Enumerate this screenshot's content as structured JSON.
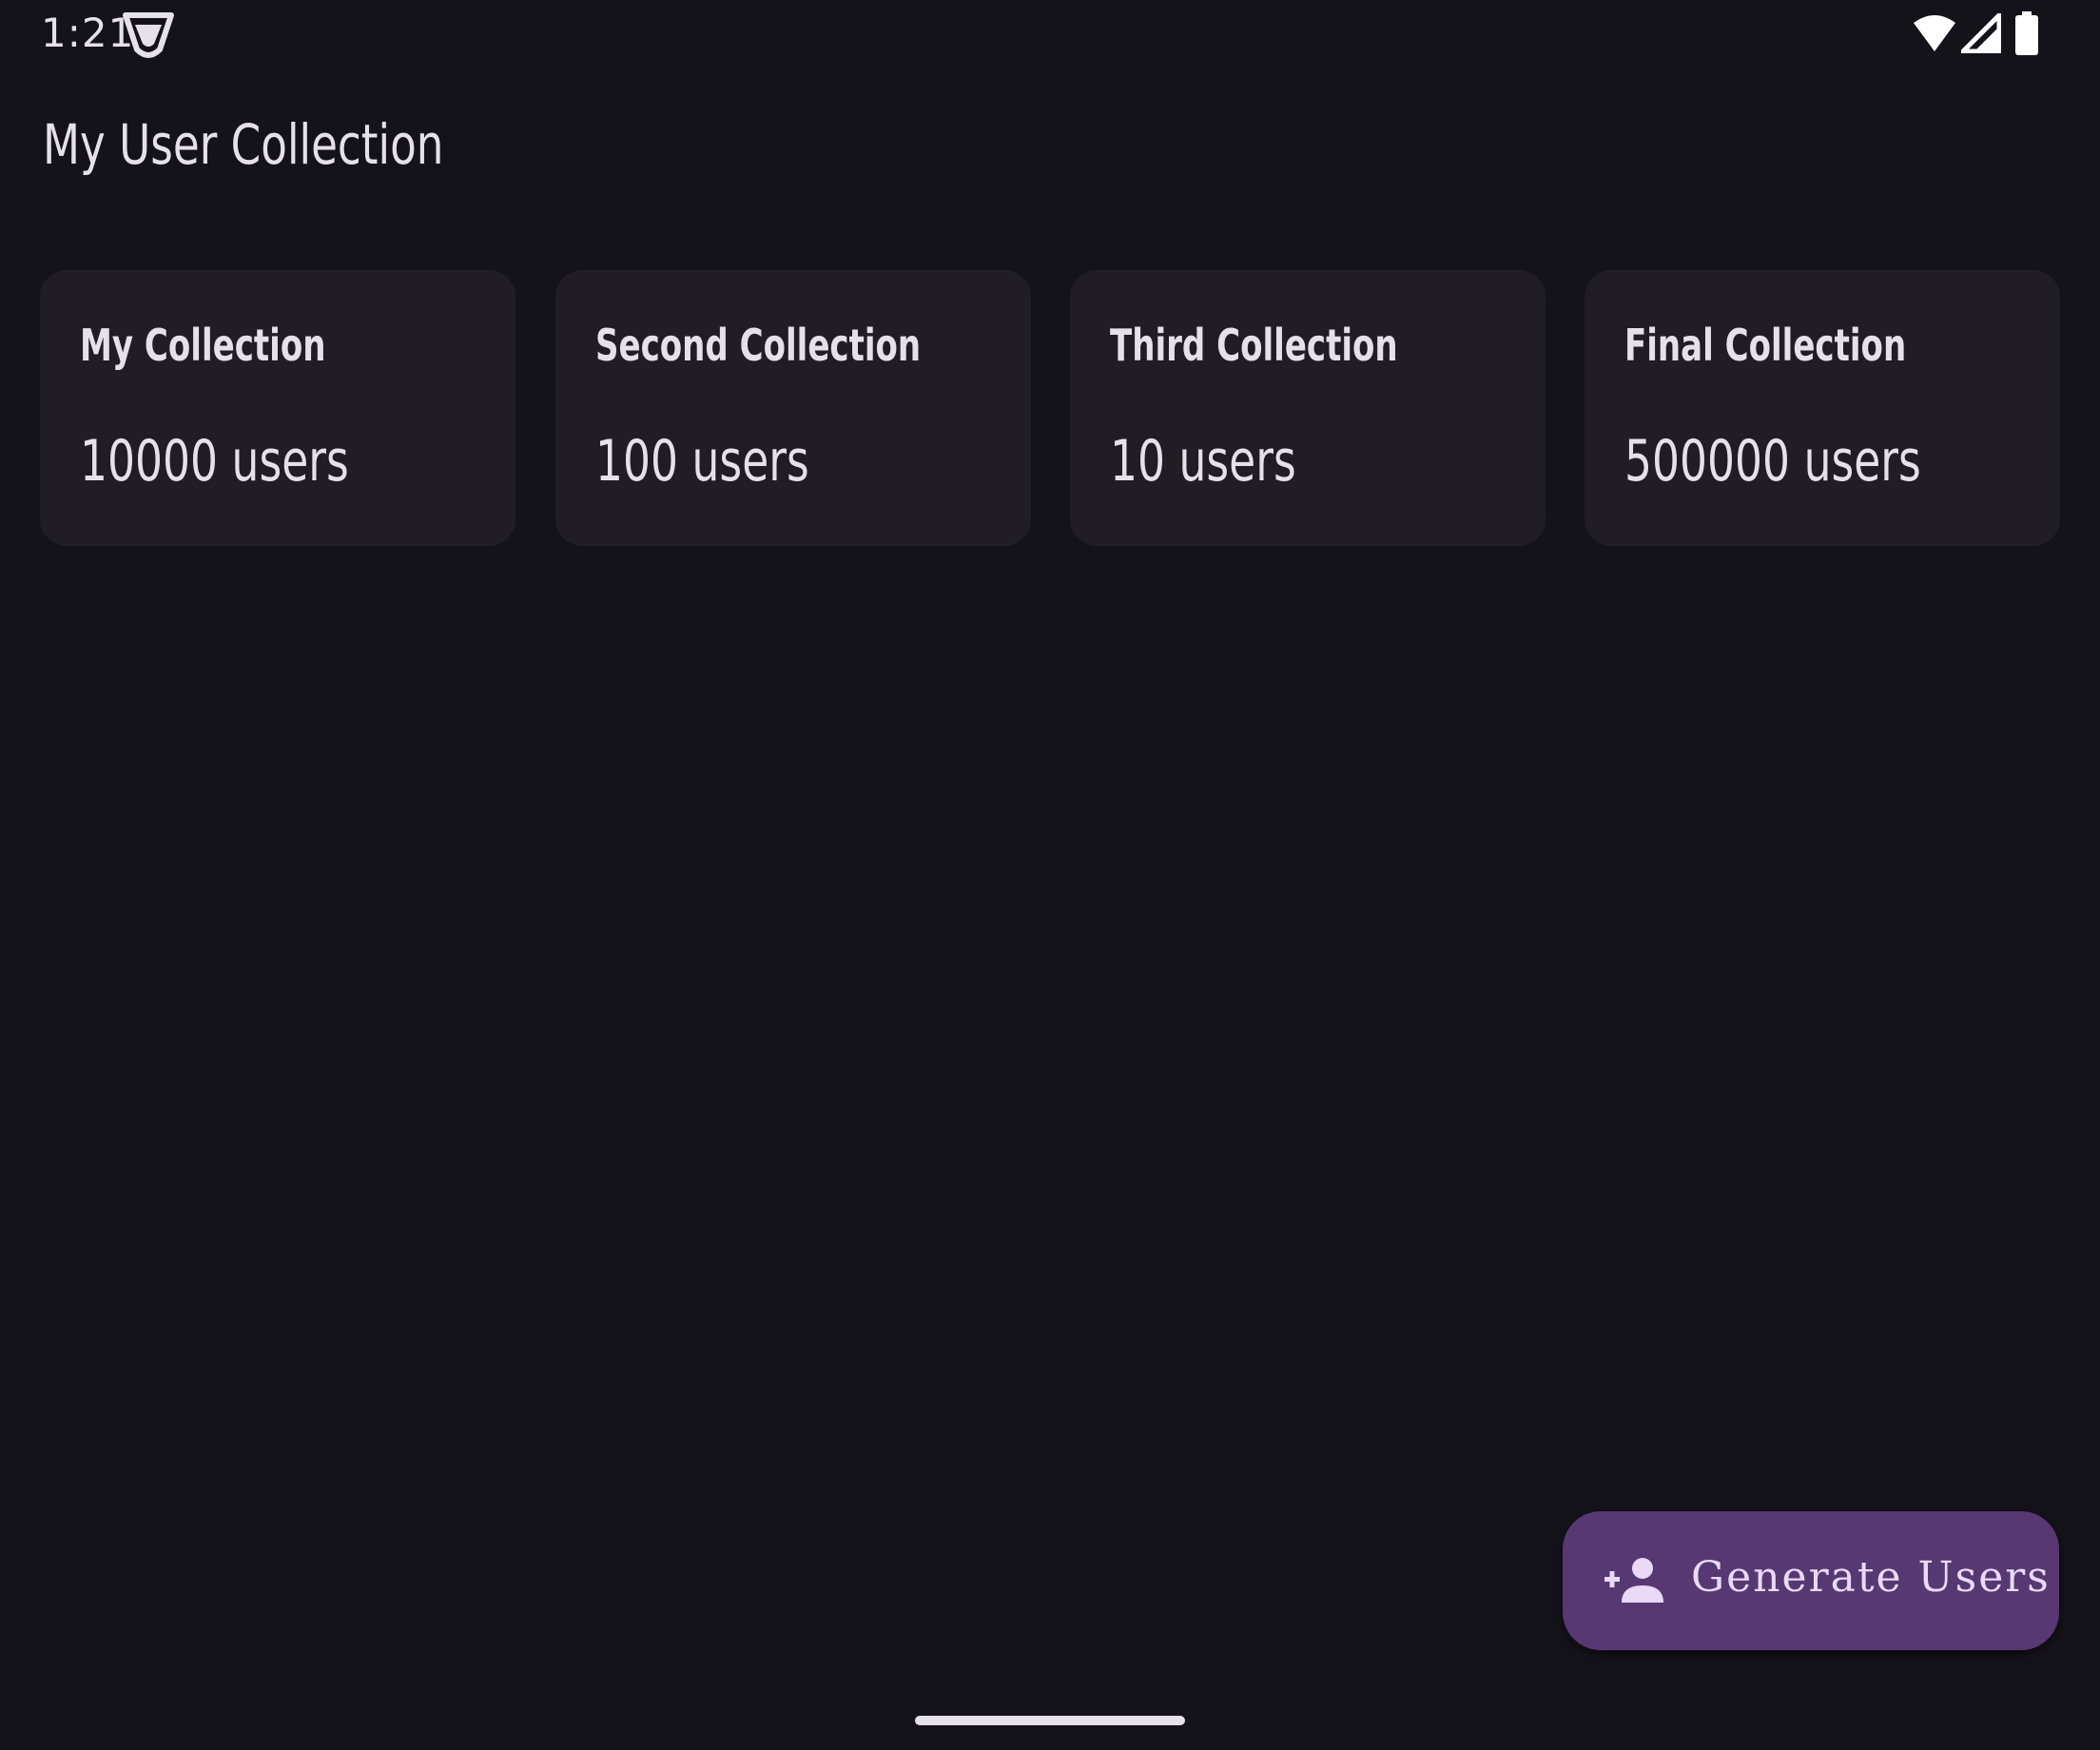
{
  "status_bar": {
    "time": "1:21",
    "icons": [
      "app-badge-icon",
      "wifi-icon",
      "signal-icon",
      "battery-icon"
    ]
  },
  "header": {
    "title": "My User Collection"
  },
  "collections": [
    {
      "name": "My Collection",
      "count": "10000 users"
    },
    {
      "name": "Second Collection",
      "count": "100 users"
    },
    {
      "name": "Third Collection",
      "count": "10 users"
    },
    {
      "name": "Final Collection",
      "count": "500000 users"
    }
  ],
  "fab": {
    "label": "Generate Users",
    "icon": "person-add-icon"
  },
  "colors": {
    "background": "#15131a",
    "card": "#201d24",
    "fab": "#573873",
    "text": "#e6e1e8"
  }
}
